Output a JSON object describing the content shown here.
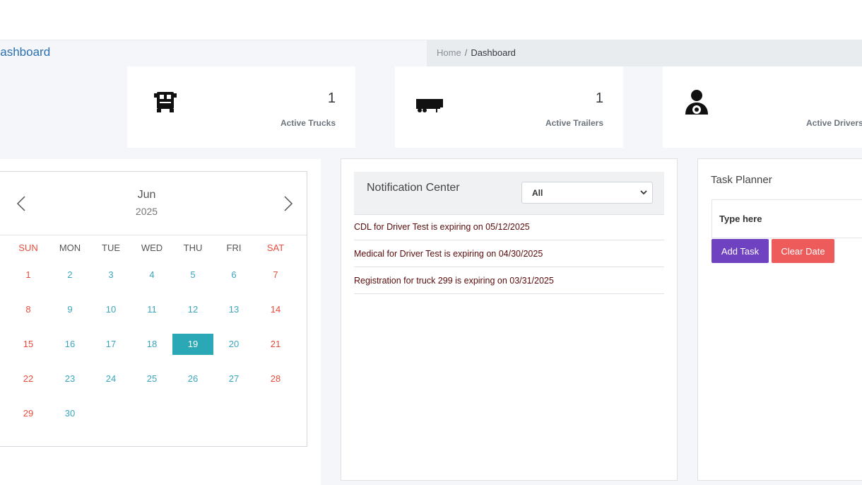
{
  "page": {
    "title": "Dashboard"
  },
  "breadcrumb": {
    "home": "Home",
    "separator": "/",
    "current": "Dashboard"
  },
  "stats": [
    {
      "icon": "truck-icon",
      "value": "1",
      "label": "Active Trucks"
    },
    {
      "icon": "trailer-icon",
      "value": "1",
      "label": "Active Trailers"
    },
    {
      "icon": "driver-icon",
      "value": "",
      "label": "Active Drivers"
    }
  ],
  "calendar": {
    "month": "Jun",
    "year": "2025",
    "weekdays": [
      "SUN",
      "MON",
      "TUE",
      "WED",
      "THU",
      "FRI",
      "SAT"
    ],
    "weeks": [
      [
        "1",
        "2",
        "3",
        "4",
        "5",
        "6",
        "7"
      ],
      [
        "8",
        "9",
        "10",
        "11",
        "12",
        "13",
        "14"
      ],
      [
        "15",
        "16",
        "17",
        "18",
        "19",
        "20",
        "21"
      ],
      [
        "22",
        "23",
        "24",
        "25",
        "26",
        "27",
        "28"
      ],
      [
        "29",
        "30",
        "",
        "",
        "",
        "",
        ""
      ]
    ],
    "selected_day": "19"
  },
  "notifications": {
    "title": "Notification Center",
    "filter_value": "All",
    "items": [
      "CDL for Driver Test is expiring on 05/12/2025",
      "Medical for Driver Test is expiring on 04/30/2025",
      "Registration for truck 299 is expiring on 03/31/2025"
    ]
  },
  "tasks": {
    "title": "Task Planner",
    "input_placeholder": "Type here",
    "add_label": "Add Task",
    "clear_label": "Clear Date"
  },
  "colors": {
    "accent_link": "#2a6fb0",
    "day_text": "#3aa6bd",
    "weekend_text": "#e74c3c",
    "selected_day_bg": "#2ba8b5",
    "notification_text": "#5a0b0b",
    "add_button": "#6f42c1",
    "clear_button": "#ee5b5b"
  }
}
